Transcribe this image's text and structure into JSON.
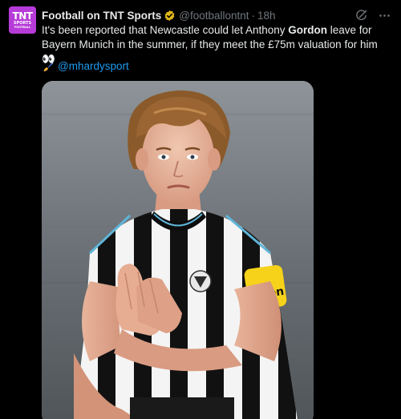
{
  "author": {
    "avatar": {
      "line1": "TNT",
      "line2": "SPORTS",
      "line3": "FOOTBALL",
      "color": "#b63bd8"
    },
    "display_name": "Football on TNT Sports",
    "handle": "@footballontnt",
    "separator": "·",
    "time": "18h",
    "verified_color": "#e2b719"
  },
  "tweet": {
    "text_before": "It's been reported that Newcastle could let Anthony ",
    "text_bold": "Gordon",
    "text_after": " leave for Bayern Munich in the summer, if they meet the £75m valuation for him 👀",
    "credit_icon": "writing-hand-emoji",
    "credit_mention": "@mhardysport"
  },
  "actions": {
    "grok_icon": "grok-icon",
    "more_icon": "more-icon"
  },
  "media": {
    "kind": "photo",
    "sponsor_badge": "noon"
  },
  "colors": {
    "background": "#000000",
    "text": "#e7e9ea",
    "muted": "#71767b",
    "link": "#1d9bf0"
  }
}
